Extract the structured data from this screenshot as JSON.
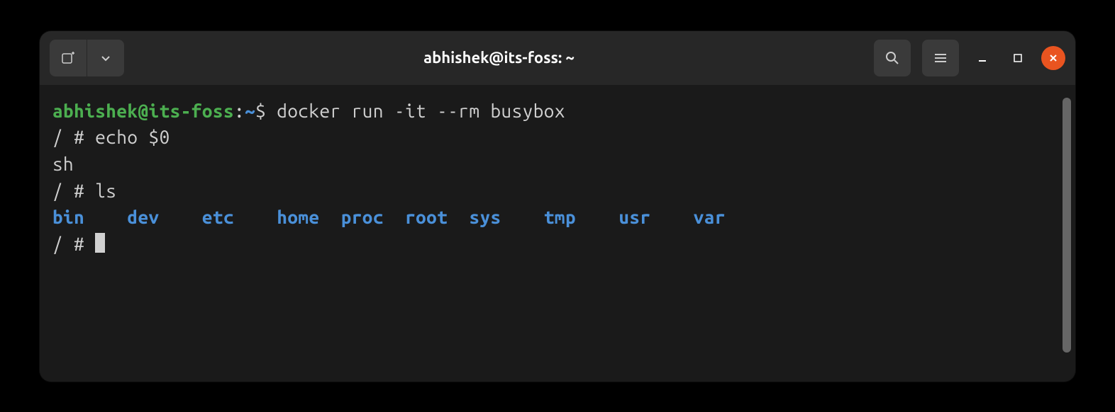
{
  "titlebar": {
    "title": "abhishek@its-foss: ~"
  },
  "terminal": {
    "prompt_user": "abhishek@its-foss",
    "prompt_sep": ":",
    "prompt_path": "~",
    "prompt_symbol": "$",
    "cmd1": "docker run -it --rm busybox",
    "line2_prompt": "/ # ",
    "line2_cmd": "echo $0",
    "line3": "sh",
    "line4_prompt": "/ # ",
    "line4_cmd": "ls",
    "dirs": [
      "bin",
      "dev",
      "etc",
      "home",
      "proc",
      "root",
      "sys",
      "tmp",
      "usr",
      "var"
    ],
    "line6_prompt": "/ # "
  }
}
